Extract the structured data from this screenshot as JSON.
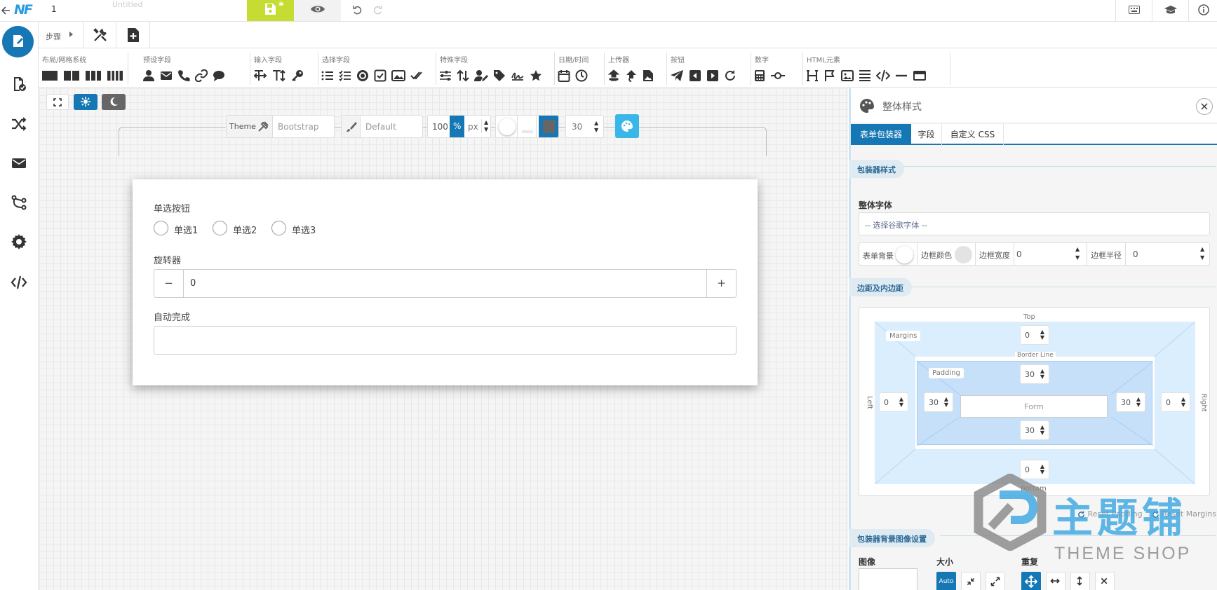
{
  "topbar": {
    "back_icon": "arrow-left-icon",
    "logo_text": "NF",
    "form_name": "1",
    "faded_name": "Untitled",
    "save_badge": "*",
    "icons": [
      "save-icon",
      "eye-icon",
      "undo-icon",
      "redo-icon",
      "keyboard-icon",
      "graduation-cap-icon",
      "info-icon"
    ]
  },
  "stepbar": {
    "steps_label": "步骤"
  },
  "toolbar": {
    "groups": {
      "layout": "布局/网格系统",
      "preset": "预设字段",
      "input": "输入字段",
      "choice": "选择字段",
      "special": "特殊字段",
      "datetime": "日期/时间",
      "upload": "上传器",
      "buttons": "按钮",
      "number": "数字",
      "html": "HTML元素"
    }
  },
  "canvas": {
    "theme_label": "Theme",
    "theme_value": "Bootstrap",
    "style_value": "Default",
    "width_value": "100",
    "unit_percent": "%",
    "unit_px": "px",
    "font_size_value": "30"
  },
  "form": {
    "radio_label": "单选按钮",
    "radios": [
      "单选1",
      "单选2",
      "单选3"
    ],
    "spinner_label": "旋转器",
    "spinner_minus": "−",
    "spinner_value": "0",
    "spinner_plus": "+",
    "autocomplete_label": "自动完成"
  },
  "panel": {
    "title": "整体样式",
    "close": "×",
    "tabs": [
      "表单包装器",
      "字段",
      "自定义 CSS"
    ],
    "wrapper_style": "包装器样式",
    "font_label": "整体字体",
    "font_placeholder": "-- 选择谷歌字体 --",
    "form_bg": "表单背景",
    "border_color": "边框颜色",
    "border_width": "边框宽度",
    "border_width_value": "0",
    "border_radius": "边框半径",
    "border_radius_value": "0",
    "margins_section": "边距及内边距",
    "box": {
      "top": "Top",
      "bottom": "Bottom",
      "left": "Left",
      "right": "Right",
      "margins": "Margins",
      "border_line": "Border Line",
      "padding": "Padding",
      "form": "Form",
      "m_top": "0",
      "m_bottom": "0",
      "m_left": "0",
      "m_right": "0",
      "p_top": "30",
      "p_bottom": "30",
      "p_left": "30",
      "p_right": "30"
    },
    "reset_padding": "Reset Padding",
    "reset_margins": "Reset Margins",
    "bg_section": "包装器背景图像设置",
    "image_label": "图像",
    "size_label": "大小",
    "repeat_label": "重复",
    "auto_label": "Auto"
  },
  "watermark": {
    "brand_cn": "主题铺",
    "brand_en": "THEME SHOP"
  },
  "colors": {
    "primary": "#1577b4",
    "accent_lime": "#c6dc32",
    "light_blue": "#3bb6e8",
    "box_outer": "#dbeefe",
    "box_inner": "#c7e0fa"
  }
}
